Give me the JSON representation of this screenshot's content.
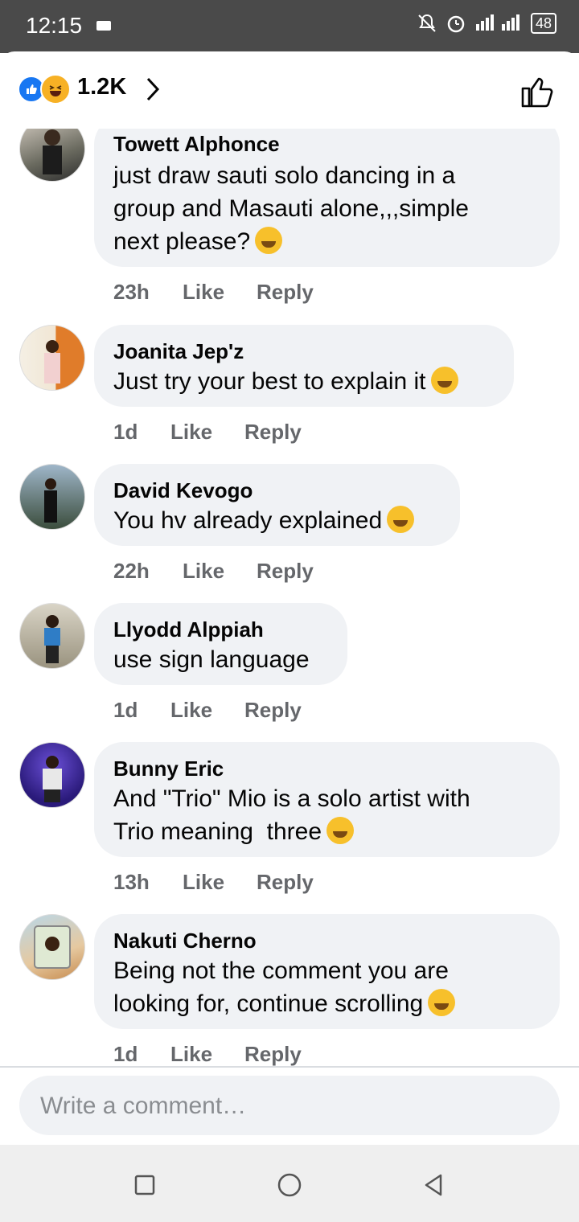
{
  "status_bar": {
    "time": "12:15",
    "network": "3G",
    "battery": "48"
  },
  "header": {
    "reactions": [
      "like-icon",
      "haha-icon"
    ],
    "reaction_count": "1.2K"
  },
  "comments": [
    {
      "author": "Towett Alphonce",
      "lines": [
        "just draw sauti solo dancing in a",
        "group and Masauti alone,,,simple",
        "next please?"
      ],
      "emoji": "hugging-face-emoji",
      "time": "23h",
      "like": "Like",
      "reply": "Reply"
    },
    {
      "author": "Joanita Jep'z",
      "lines": [
        "Just try your best to explain it"
      ],
      "emoji": "laughing-squint-emoji",
      "time": "1d",
      "like": "Like",
      "reply": "Reply"
    },
    {
      "author": "David Kevogo",
      "lines": [
        "You hv already explained"
      ],
      "emoji": "grinning-emoji",
      "time": "22h",
      "like": "Like",
      "reply": "Reply"
    },
    {
      "author": "Llyodd Alppiah",
      "lines": [
        "use sign language"
      ],
      "emoji": "",
      "time": "1d",
      "like": "Like",
      "reply": "Reply"
    },
    {
      "author": "Bunny Eric",
      "lines": [
        "And \"Trio\" Mio is a solo artist with",
        "Trio meaning  three"
      ],
      "emoji": "tears-of-joy-emoji",
      "time": "13h",
      "like": "Like",
      "reply": "Reply"
    },
    {
      "author": "Nakuti Cherno",
      "lines": [
        "Being not the comment you are",
        "looking for, continue scrolling"
      ],
      "emoji": "eye-roll-emoji",
      "time": "1d",
      "like": "Like",
      "reply": "Reply"
    }
  ],
  "composer": {
    "placeholder": "Write a comment…"
  },
  "colors": {
    "like_blue": "#1877f2",
    "bubble_bg": "#f0f2f5",
    "meta_gray": "#65676b"
  }
}
